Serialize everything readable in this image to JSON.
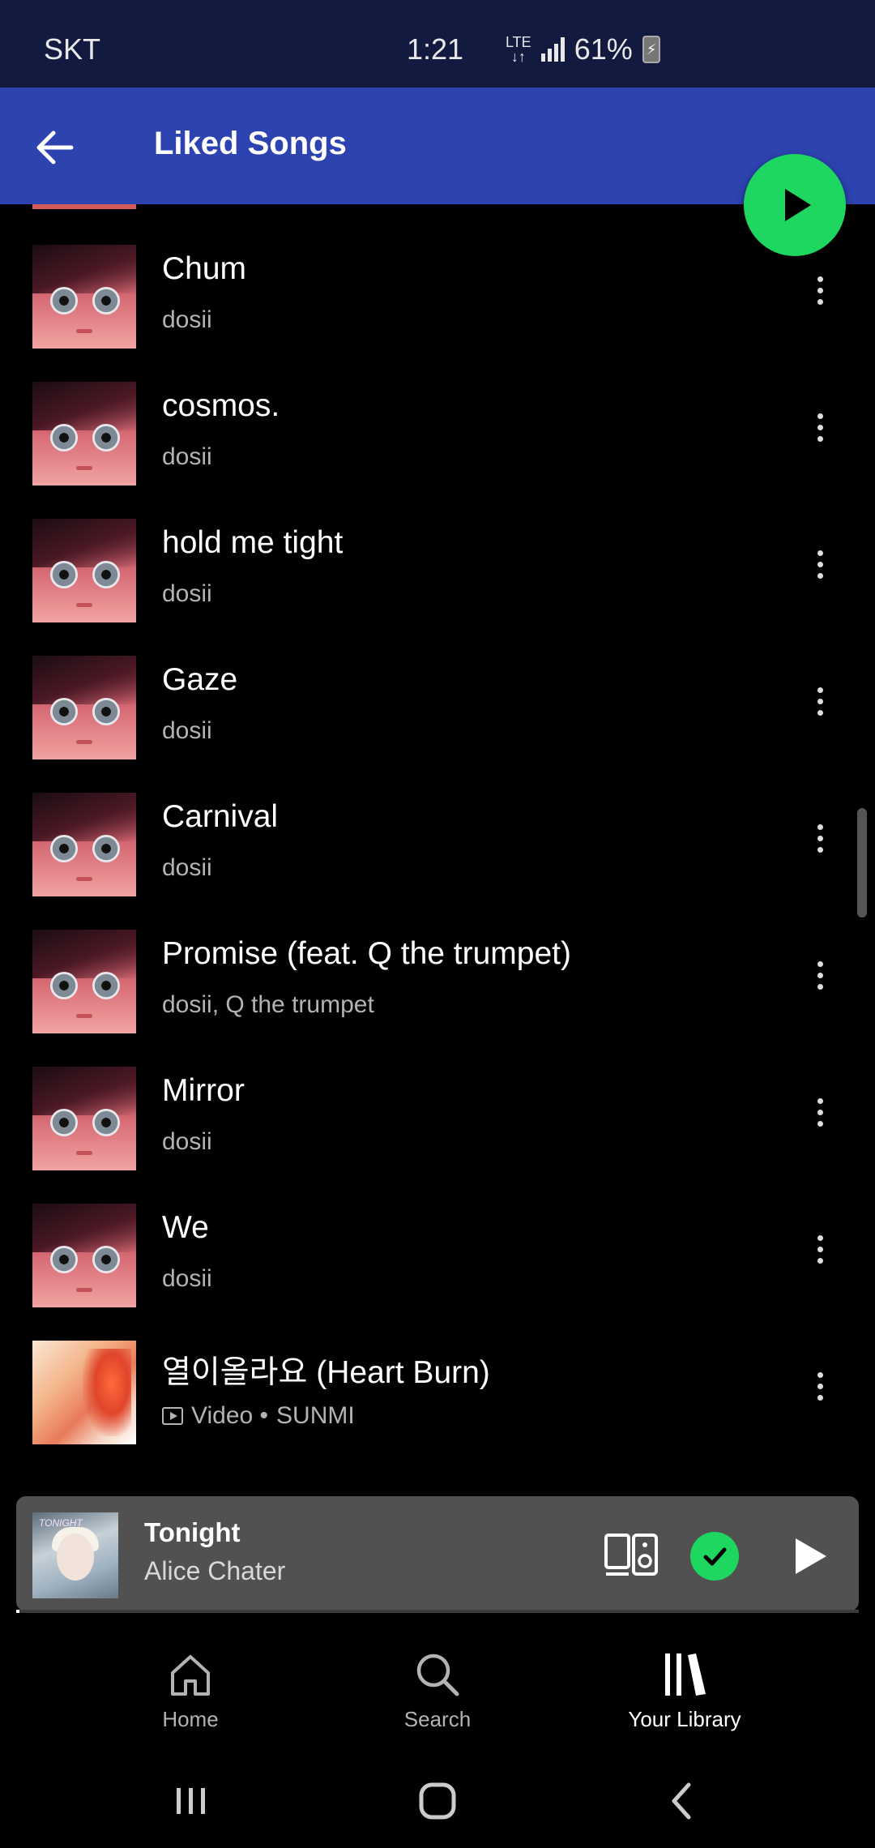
{
  "status_bar": {
    "carrier": "SKT",
    "time": "1:21",
    "network": "LTE",
    "battery": "61%"
  },
  "header": {
    "title": "Liked Songs"
  },
  "songs": [
    {
      "title": "Chum",
      "artist": "dosii"
    },
    {
      "title": "cosmos.",
      "artist": "dosii"
    },
    {
      "title": "hold me tight",
      "artist": "dosii"
    },
    {
      "title": "Gaze",
      "artist": "dosii"
    },
    {
      "title": "Carnival",
      "artist": "dosii"
    },
    {
      "title": "Promise (feat. Q the trumpet)",
      "artist": "dosii, Q the trumpet"
    },
    {
      "title": "Mirror",
      "artist": "dosii"
    },
    {
      "title": "We",
      "artist": "dosii"
    },
    {
      "title": "열이올라요 (Heart Burn)",
      "type_label": "Video •",
      "artist": "SUNMI"
    }
  ],
  "now_playing": {
    "title": "Tonight",
    "artist": "Alice Chater",
    "art_text": "TONIGHT",
    "progress": 0.004
  },
  "nav": {
    "home": "Home",
    "search": "Search",
    "library": "Your Library"
  },
  "colors": {
    "accent_green": "#1ed760",
    "header_blue": "#2d43b0",
    "status_bar_bg": "#121a3f"
  }
}
